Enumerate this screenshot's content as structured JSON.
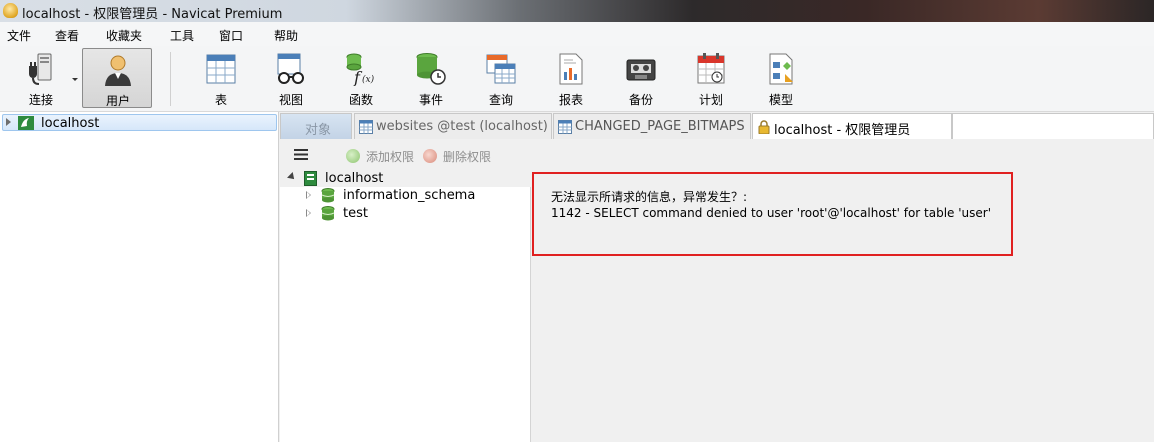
{
  "window": {
    "title": "localhost - 权限管理员 - Navicat Premium"
  },
  "menu": [
    "文件",
    "查看",
    "收藏夹",
    "工具",
    "窗口",
    "帮助"
  ],
  "toolbar": {
    "connect_label": "连接",
    "user_label": "用户",
    "items": [
      "表",
      "视图",
      "函数",
      "事件",
      "查询",
      "报表",
      "备份",
      "计划",
      "模型"
    ]
  },
  "left_tree": {
    "connection": "localhost"
  },
  "tabs": {
    "objects": "对象",
    "websites": "websites @test (localhost) -...",
    "changed": "CHANGED_PAGE_BITMAPS ...",
    "privileges": "localhost - 权限管理员"
  },
  "priv_toolbar": {
    "add": "添加权限",
    "delete": "删除权限"
  },
  "priv_tree": {
    "root": "localhost",
    "databases": [
      "information_schema",
      "test"
    ]
  },
  "error": {
    "title": "无法显示所请求的信息，异常发生？:",
    "message": "1142 - SELECT command denied to user 'root'@'localhost' for table 'user'"
  },
  "colors": {
    "error_border": "#e02020",
    "selection": "#d6e7fa"
  }
}
